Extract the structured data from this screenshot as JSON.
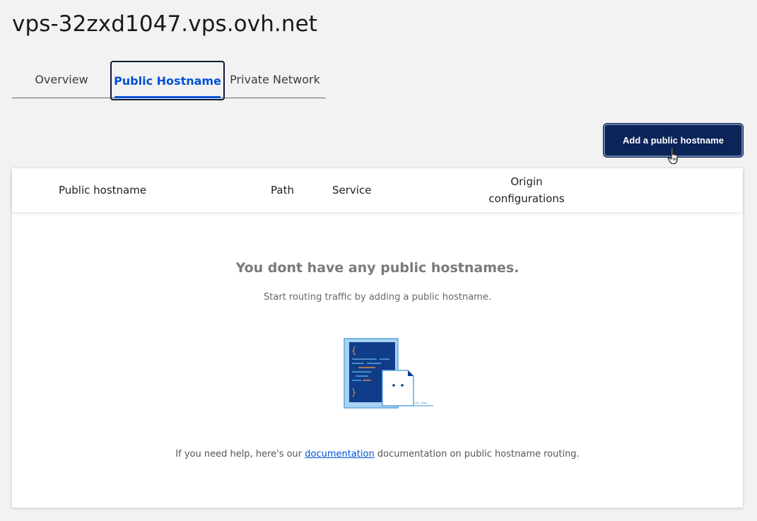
{
  "page": {
    "title": "vps-32zxd1047.vps.ovh.net"
  },
  "tabs": [
    {
      "label": "Overview",
      "active": false
    },
    {
      "label": "Public Hostname",
      "active": true
    },
    {
      "label": "Private Network",
      "active": false
    }
  ],
  "actions": {
    "add_label": "Add a public hostname"
  },
  "table": {
    "columns": [
      "Public hostname",
      "Path",
      "Service",
      "Origin configurations"
    ]
  },
  "empty_state": {
    "title": "You dont have any public hostnames.",
    "subtitle": "Start routing traffic by adding a public hostname.",
    "help_prefix": "If you need help, here's our ",
    "help_link": "documentation",
    "help_suffix": " documentation on public hostname routing.",
    "illustration": "code-document-icon"
  },
  "colors": {
    "accent": "#0050d7",
    "primary_button": "#0b2559",
    "background": "#f2f2f2"
  }
}
